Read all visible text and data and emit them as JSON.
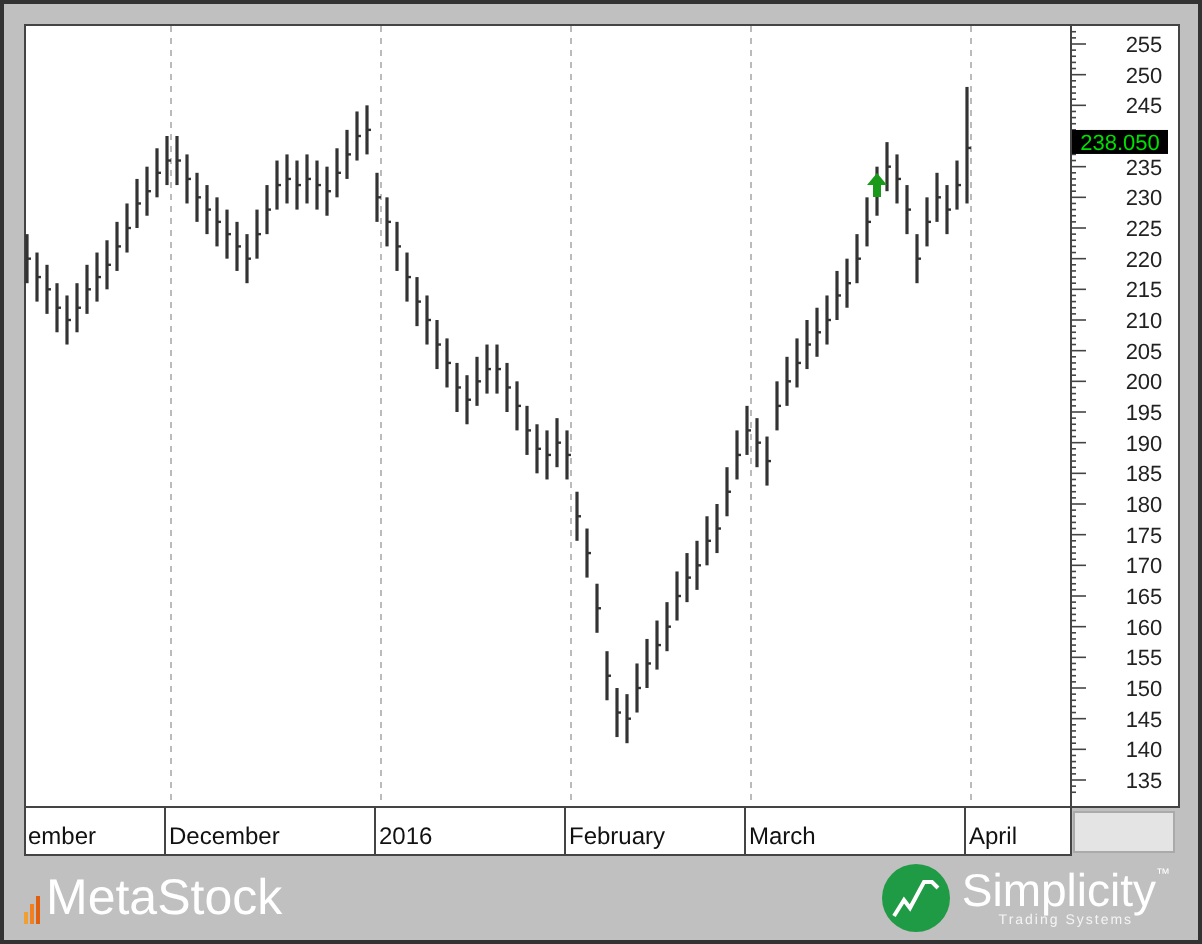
{
  "chart": {
    "y_axis_labels": [
      "255",
      "250",
      "245",
      "235",
      "230",
      "225",
      "220",
      "215",
      "210",
      "205",
      "200",
      "195",
      "190",
      "185",
      "180",
      "175",
      "170",
      "165",
      "160",
      "155",
      "150",
      "145",
      "140",
      "135"
    ],
    "x_axis_labels": [
      "ember",
      "December",
      "2016",
      "February",
      "March",
      "April"
    ],
    "last_price_label": "238.050"
  },
  "footer": {
    "left_logo": "MetaStock",
    "right_logo": {
      "name": "Simplicity",
      "tagline": "Trading Systems",
      "mark": "™"
    }
  }
}
